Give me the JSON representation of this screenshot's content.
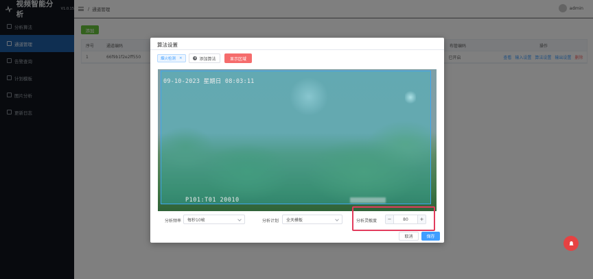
{
  "app": {
    "title": "视频智能分析",
    "version": "V1.0.15"
  },
  "sidebar": {
    "items": [
      {
        "label": "分析算法",
        "active": false
      },
      {
        "label": "通道管理",
        "active": true
      },
      {
        "label": "告警查询",
        "active": false
      },
      {
        "label": "计划模板",
        "active": false
      },
      {
        "label": "图片分析",
        "active": false
      },
      {
        "label": "更新日志",
        "active": false
      }
    ]
  },
  "topbar": {
    "crumb": "通道管理",
    "user": "admin"
  },
  "main": {
    "add_label": "添加",
    "table": {
      "headers": [
        "序号",
        "通道编码",
        "布管编码",
        "操作"
      ],
      "rows": [
        {
          "index": "1",
          "code": "66f9b1f2e2ff550",
          "status": "已开启"
        }
      ],
      "actions": [
        "查看",
        "输入设置",
        "算法设置",
        "输出设置",
        "删除"
      ]
    }
  },
  "dialog": {
    "title": "算法设置",
    "tag": "烟火检测",
    "add_algo_label": "添加算法",
    "show_area_label": "显示区域",
    "video": {
      "date_text": "09-10-2023 星期日 08:03:11",
      "camera_text": "P101:T01   20010"
    },
    "form": {
      "freq_label": "分析频率",
      "freq_value": "每秒10帧",
      "plan_label": "分析计划",
      "plan_value": "全天模板",
      "sens_label": "分析灵敏度",
      "sens_value": "80",
      "minus": "−",
      "plus": "+"
    },
    "cancel_label": "取消",
    "save_label": "保存"
  },
  "colors": {
    "accent": "#409eff",
    "danger": "#f56c6c",
    "highlight": "#e23b5c",
    "sidebar_bg": "#10151d",
    "active_nav": "#1f5fa5"
  }
}
